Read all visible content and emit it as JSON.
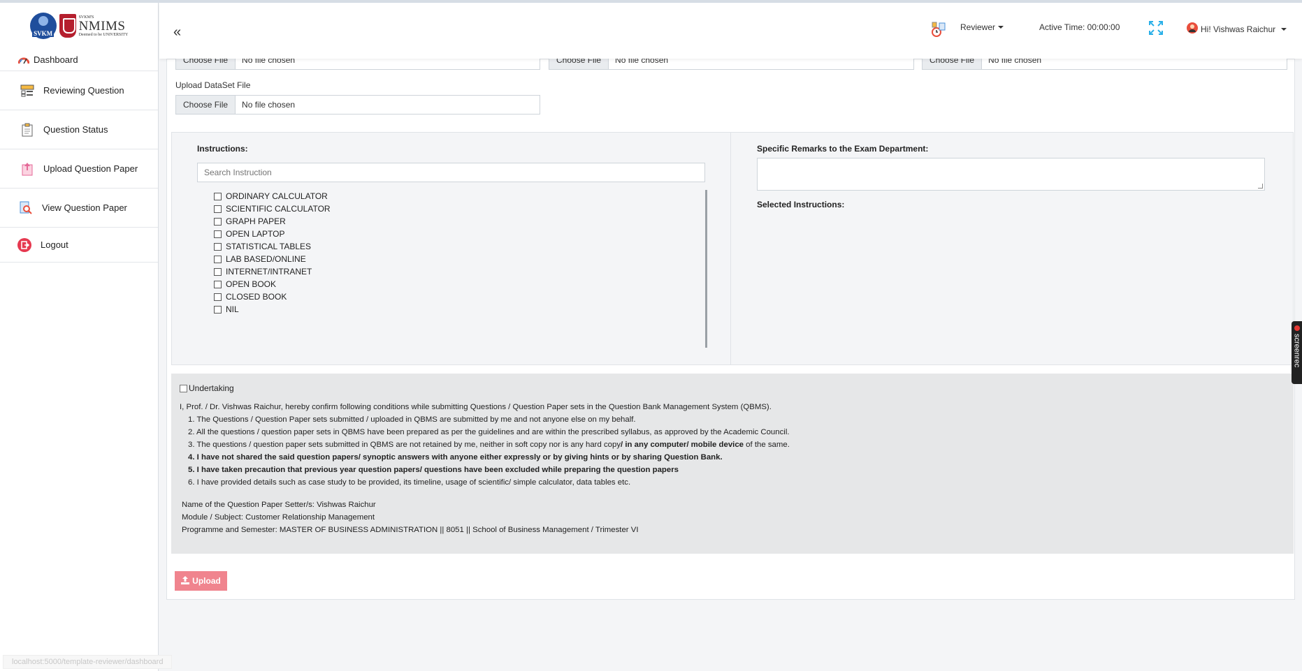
{
  "logos": {
    "svkm_badge": "SVKM",
    "nmims_small": "SVKM'S",
    "nmims_big": "NMIMS",
    "nmims_sub": "Deemed to be UNIVERSITY"
  },
  "sidebar": {
    "items": [
      {
        "label": "Dashboard",
        "icon": "dashboard-gauge-icon"
      },
      {
        "label": "Reviewing Question",
        "icon": "reviewing-question-icon"
      },
      {
        "label": "Question Status",
        "icon": "clipboard-icon"
      },
      {
        "label": "Upload Question Paper",
        "icon": "upload-paper-icon"
      },
      {
        "label": "View Question Paper",
        "icon": "magnifier-paper-icon"
      },
      {
        "label": "Logout",
        "icon": "logout-icon"
      }
    ]
  },
  "header": {
    "collapse": "«",
    "role": "Reviewer",
    "active_time": "Active Time: 00:00:00",
    "user": "Hi! Vishwas Raichur"
  },
  "files": {
    "choose_label": "Choose File",
    "no_file": "No file chosen",
    "dataset_label": "Upload DataSet File"
  },
  "instructions": {
    "title": "Instructions:",
    "search_placeholder": "Search Instruction",
    "items": [
      "ORDINARY CALCULATOR",
      "SCIENTIFIC CALCULATOR",
      "GRAPH PAPER",
      "OPEN LAPTOP",
      "STATISTICAL TABLES",
      "LAB BASED/ONLINE",
      "INTERNET/INTRANET",
      "OPEN BOOK",
      "CLOSED BOOK",
      "NIL"
    ]
  },
  "remarks": {
    "title": "Specific Remarks to the Exam Department:",
    "selected_title": "Selected Instructions:"
  },
  "undertaking": {
    "label": "Undertaking",
    "intro": "I, Prof. / Dr. Vishwas Raichur, hereby confirm following conditions while submitting Questions / Question Paper sets in the Question Bank Management System (QBMS).",
    "points": {
      "p1": "1. The Questions / Question Paper sets submitted / uploaded in QBMS are submitted by me and not anyone else on my behalf.",
      "p2": "2. All the questions / question paper sets in QBMS have been prepared as per the guidelines and are within the prescribed syllabus, as approved by the Academic Council.",
      "p3a": "3. The questions / question paper sets submitted in QBMS are not retained by me, neither in soft copy nor is any hard copy",
      "p3b": "/ in any computer/ mobile device",
      "p3c": " of the same.",
      "p4": "4. I have not shared the said question papers/ synoptic answers with anyone either expressly or by giving hints or by sharing Question Bank.",
      "p5": "5. I have taken precaution that previous year question papers/ questions have been excluded while preparing the question papers",
      "p6": "6. I have provided details such as case study to be provided, its timeline, usage of scientific/ simple calculator, data tables etc."
    },
    "setter": "Name of the Question Paper Setter/s: Vishwas Raichur",
    "module": "Module / Subject: Customer Relationship Management",
    "programme": "Programme and Semester: MASTER OF BUSINESS ADMINISTRATION || 8051 || School of Business Management / Trimester VI"
  },
  "upload_button": "Upload",
  "status_url": "localhost:5000/template-reviewer/dashboard",
  "screenrec": "screenrec",
  "colors": {
    "upload_btn": "#f0848e",
    "panel_bg": "#f4f5f7",
    "undertaking_bg": "#e6e7e8"
  }
}
